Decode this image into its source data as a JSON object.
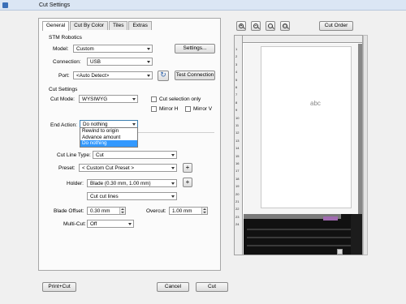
{
  "window": {
    "title": "Cut Settings"
  },
  "tabs": [
    "General",
    "Cut By Color",
    "Tiles",
    "Extras"
  ],
  "device": {
    "section": "STM Robotics",
    "model_label": "Model:",
    "model_value": "Custom",
    "settings_button": "Settings...",
    "connection_label": "Connection:",
    "connection_value": "USB",
    "port_label": "Port:",
    "port_value": "<Auto Detect>",
    "refresh_icon": "refresh-icon",
    "test_button": "Test Connection"
  },
  "cut": {
    "section": "Cut Settings",
    "mode_label": "Cut Mode:",
    "mode_value": "WYSIWYG",
    "cut_selection_only": "Cut selection only",
    "mirror_h": "Mirror H",
    "mirror_v": "Mirror V",
    "end_action_label": "End Action:",
    "end_action_value": "Do nothing",
    "end_action_options": [
      "Rewind to origin",
      "Advance amount",
      "Do nothing"
    ],
    "cut_line_type_label": "Cut Line Type:",
    "cut_line_type_value": "Cut",
    "preset_label": "Preset:",
    "preset_value": "< Custom Cut Preset >",
    "holder_label": "Holder:",
    "holder_value": "Blade (0.30 mm, 1.00 mm)",
    "cut_lines_value": "Cut cut lines",
    "blade_offset_label": "Blade Offset:",
    "blade_offset_value": "0.30 mm",
    "overcut_label": "Overcut:",
    "overcut_value": "1.00 mm",
    "multi_cut_label": "Multi-Cut:",
    "multi_cut_value": "Off"
  },
  "preview": {
    "cut_order_button": "Cut Order",
    "zoom_buttons": [
      "zoom-in-icon",
      "zoom-out-icon",
      "zoom-fit-icon",
      "zoom-page-icon"
    ],
    "sample_text": "abc",
    "ruler_numbers": [
      "1",
      "2",
      "3",
      "4",
      "5",
      "6",
      "7",
      "8",
      "9",
      "10",
      "11",
      "12",
      "13",
      "14",
      "15",
      "16",
      "17",
      "18",
      "19",
      "20",
      "21",
      "22",
      "23",
      "24"
    ]
  },
  "footer": {
    "print_cut": "Print+Cut",
    "cancel": "Cancel",
    "cut": "Cut"
  }
}
